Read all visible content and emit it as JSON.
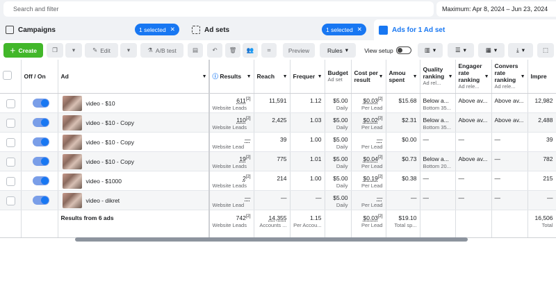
{
  "search": {
    "placeholder": "Search and filter"
  },
  "date_range": "Maximum: Apr 8, 2024 – Jun 23, 2024",
  "tabs": {
    "campaigns": {
      "label": "Campaigns",
      "pill": "1 selected"
    },
    "adsets": {
      "label": "Ad sets",
      "pill": "1 selected"
    },
    "ads": {
      "label": "Ads for 1 Ad set"
    }
  },
  "toolbar": {
    "create": "Create",
    "edit": "Edit",
    "ab_test": "A/B test",
    "preview": "Preview",
    "rules": "Rules",
    "view_setup": "View setup"
  },
  "columns": {
    "off_on": "Off / On",
    "ad": "Ad",
    "results": "Results",
    "reach": "Reach",
    "frequency": "Frequer",
    "budget": "Budget",
    "budget_sub": "Ad set",
    "cost": "Cost per result",
    "amount": "Amou spent",
    "quality": "Quality ranking",
    "quality_sub": "Ad rel...",
    "engagement": "Engager rate ranking",
    "engagement_sub": "Ad rele...",
    "conversion": "Convers rate ranking",
    "conversion_sub": "Ad rele...",
    "impressions": "Impre"
  },
  "rows": [
    {
      "name": "video - $10",
      "results": "611",
      "results_sup": "[2]",
      "results_sub": "Website Leads",
      "reach": "11,591",
      "freq": "1.12",
      "budget": "$5.00",
      "budget_sub": "Daily",
      "cost": "$0.03",
      "cost_sup": "[2]",
      "cost_sub": "Per Lead",
      "spent": "$15.68",
      "quality": "Below a...",
      "quality_sub": "Bottom 35...",
      "engagement": "Above av...",
      "conversion": "Above av...",
      "impressions": "12,982"
    },
    {
      "name": "video - $10 - Copy",
      "results": "110",
      "results_sup": "[2]",
      "results_sub": "Website Leads",
      "reach": "2,425",
      "freq": "1.03",
      "budget": "$5.00",
      "budget_sub": "Daily",
      "cost": "$0.02",
      "cost_sup": "[2]",
      "cost_sub": "Per Lead",
      "spent": "$2.31",
      "quality": "Below a...",
      "quality_sub": "Bottom 35...",
      "engagement": "Above av...",
      "conversion": "Above av...",
      "impressions": "2,488"
    },
    {
      "name": "video - $10 - Copy",
      "results": "—",
      "results_sup": "",
      "results_sub": "Website Lead",
      "reach": "39",
      "freq": "1.00",
      "budget": "$5.00",
      "budget_sub": "Daily",
      "cost": "—",
      "cost_sup": "",
      "cost_sub": "Per Lead",
      "spent": "$0.00",
      "quality": "—",
      "quality_sub": "",
      "engagement": "—",
      "conversion": "—",
      "impressions": "39"
    },
    {
      "name": "video - $10 - Copy",
      "results": "19",
      "results_sup": "[2]",
      "results_sub": "Website Leads",
      "reach": "775",
      "freq": "1.01",
      "budget": "$5.00",
      "budget_sub": "Daily",
      "cost": "$0.04",
      "cost_sup": "[2]",
      "cost_sub": "Per Lead",
      "spent": "$0.73",
      "quality": "Below a...",
      "quality_sub": "Bottom 20...",
      "engagement": "Above av...",
      "conversion": "—",
      "impressions": "782"
    },
    {
      "name": "video - $1000",
      "results": "2",
      "results_sup": "[2]",
      "results_sub": "Website Leads",
      "reach": "214",
      "freq": "1.00",
      "budget": "$5.00",
      "budget_sub": "Daily",
      "cost": "$0.19",
      "cost_sup": "[2]",
      "cost_sub": "Per Lead",
      "spent": "$0.38",
      "quality": "—",
      "quality_sub": "",
      "engagement": "—",
      "conversion": "—",
      "impressions": "215"
    },
    {
      "name": "video - dikret",
      "results": "—",
      "results_sup": "",
      "results_sub": "Website Lead",
      "reach": "—",
      "freq": "—",
      "budget": "$5.00",
      "budget_sub": "Daily",
      "cost": "—",
      "cost_sup": "",
      "cost_sub": "Per Lead",
      "spent": "—",
      "quality": "—",
      "quality_sub": "",
      "engagement": "—",
      "conversion": "—",
      "impressions": "—"
    }
  ],
  "totals": {
    "label": "Results from 6 ads",
    "results": "742",
    "results_sup": "[2]",
    "results_sub": "Website Leads",
    "reach": "14,355",
    "reach_sub": "Accounts ...",
    "freq": "1.15",
    "freq_sub": "Per Accou...",
    "cost": "$0.03",
    "cost_sup": "[2]",
    "cost_sub": "Per Lead",
    "spent": "$19.10",
    "spent_sub": "Total sp...",
    "impressions": "16,506",
    "impressions_sub": "Total"
  }
}
